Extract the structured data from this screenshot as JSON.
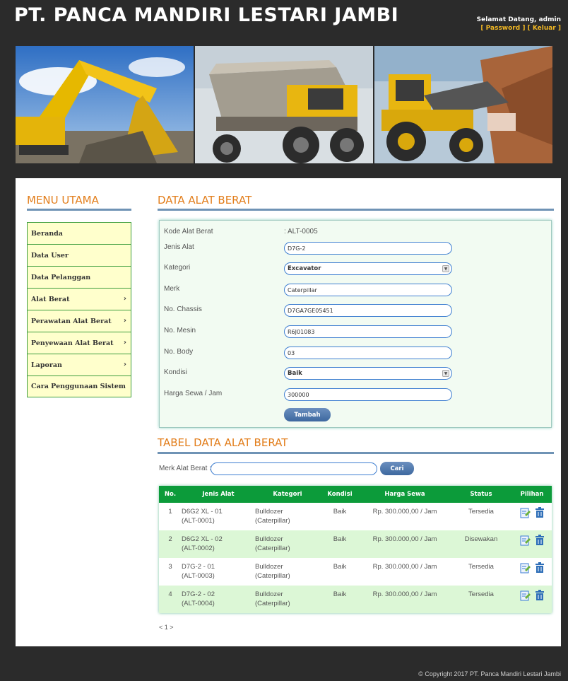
{
  "header": {
    "title": "PT. PANCA MANDIRI LESTARI JAMBI",
    "greeting": "Selamat Datang, admin",
    "password_link": "[ Password ]",
    "logout_link": "[ Keluar ]"
  },
  "sidebar": {
    "title": "MENU UTAMA",
    "items": [
      {
        "label": "Beranda",
        "arrow": ""
      },
      {
        "label": "Data User",
        "arrow": ""
      },
      {
        "label": "Data Pelanggan",
        "arrow": ""
      },
      {
        "label": "Alat Berat",
        "arrow": "›"
      },
      {
        "label": "Perawatan Alat Berat",
        "arrow": "›"
      },
      {
        "label": "Penyewaan Alat Berat",
        "arrow": "›"
      },
      {
        "label": "Laporan",
        "arrow": "›"
      },
      {
        "label": "Cara Penggunaan Sistem",
        "arrow": ""
      }
    ]
  },
  "form": {
    "title": "DATA ALAT BERAT",
    "kode_label": "Kode Alat Berat",
    "kode_value": ": ALT-0005",
    "jenis_label": "Jenis Alat",
    "jenis_value": "D7G-2",
    "kategori_label": "Kategori",
    "kategori_value": "Excavator",
    "merk_label": "Merk",
    "merk_value": "Caterpillar",
    "chassis_label": "No. Chassis",
    "chassis_value": "D7GA7GE05451",
    "mesin_label": "No. Mesin",
    "mesin_value": "R6J01083",
    "body_label": "No. Body",
    "body_value": "03",
    "kondisi_label": "Kondisi",
    "kondisi_value": "Baik",
    "harga_label": "Harga Sewa / Jam",
    "harga_value": "300000",
    "submit_label": "Tambah"
  },
  "table_section": {
    "title": "TABEL DATA ALAT BERAT",
    "search_label": "Merk Alat Berat :",
    "search_button": "Cari",
    "columns": [
      "No.",
      "Jenis Alat",
      "Kategori",
      "Kondisi",
      "Harga Sewa",
      "Status",
      "Pilihan"
    ],
    "rows": [
      {
        "no": "1",
        "jenis": "D6G2 XL - 01",
        "kode": "(ALT-0001)",
        "kategori": "Bulldozer",
        "merk": "(Caterpillar)",
        "kondisi": "Baik",
        "harga": "Rp. 300.000,00 / Jam",
        "status": "Tersedia"
      },
      {
        "no": "2",
        "jenis": "D6G2 XL - 02",
        "kode": "(ALT-0002)",
        "kategori": "Bulldozer",
        "merk": "(Caterpillar)",
        "kondisi": "Baik",
        "harga": "Rp. 300.000,00 / Jam",
        "status": "Disewakan"
      },
      {
        "no": "3",
        "jenis": "D7G-2 - 01",
        "kode": "(ALT-0003)",
        "kategori": "Bulldozer",
        "merk": "(Caterpillar)",
        "kondisi": "Baik",
        "harga": "Rp. 300.000,00 / Jam",
        "status": "Tersedia"
      },
      {
        "no": "4",
        "jenis": "D7G-2 - 02",
        "kode": "(ALT-0004)",
        "kategori": "Bulldozer",
        "merk": "(Caterpillar)",
        "kondisi": "Baik",
        "harga": "Rp. 300.000,00 / Jam",
        "status": "Tersedia"
      }
    ],
    "pager": "< 1 >"
  },
  "footer": {
    "copyright": "© Copyright 2017 PT. Panca Mandiri Lestari Jambi"
  },
  "icons": {
    "edit": "edit-icon",
    "delete": "delete-icon",
    "dropdown": "chevron-down-icon"
  },
  "colors": {
    "accent_orange": "#e27d1a",
    "table_header": "#0c9b3a",
    "menu_bg": "#ffffcc",
    "button": "#4a74aa"
  }
}
